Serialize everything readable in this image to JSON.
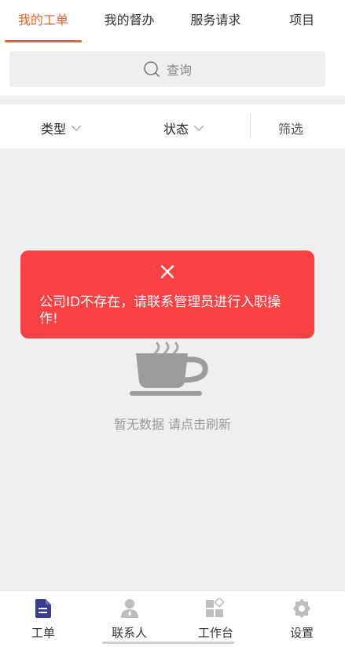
{
  "tabs": [
    {
      "label": "我的工单",
      "active": true
    },
    {
      "label": "我的督办"
    },
    {
      "label": "服务请求"
    },
    {
      "label": "项目"
    }
  ],
  "search": {
    "placeholder": "查询",
    "icon": "search-icon"
  },
  "filters": {
    "type_label": "类型",
    "status_label": "状态",
    "screen_label": "筛选"
  },
  "empty": {
    "text": "暂无数据 请点击刷新",
    "icon": "coffee-cup-icon"
  },
  "toast": {
    "message": "公司ID不存在，请联系管理员进行入职操作!",
    "icon": "close-icon"
  },
  "bottom_nav": [
    {
      "label": "工单",
      "icon": "document-icon",
      "active": true
    },
    {
      "label": "联系人",
      "icon": "contact-icon"
    },
    {
      "label": "工作台",
      "icon": "workbench-icon"
    },
    {
      "label": "设置",
      "icon": "gear-icon"
    }
  ],
  "colors": {
    "accent": "#f0612a",
    "toast_bg": "#fa4245",
    "nav_active": "#3a3d8f",
    "nav_inactive": "#bdbdbd"
  }
}
